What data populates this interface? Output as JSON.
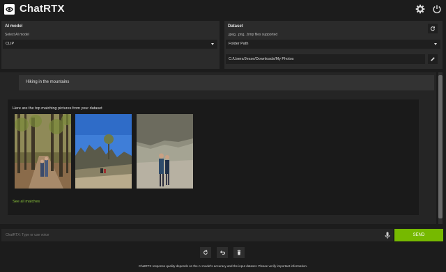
{
  "app": {
    "title": "ChatRTX"
  },
  "header": {
    "settings_icon": "gear-icon",
    "power_icon": "power-icon"
  },
  "ai_model": {
    "title": "AI model",
    "select_label": "Select AI model",
    "selected": "CLIP"
  },
  "dataset": {
    "title": "Dataset",
    "supported": ".jpeg, .png, .bmp files supported",
    "selected": "Folder Path",
    "path": "C:/Users/Jesse/Downloads/My Photos",
    "refresh_icon": "refresh-icon",
    "edit_icon": "pencil-icon"
  },
  "chat": {
    "query": "Hiking in the mountains",
    "response_text": "Here are the top matching pictures from your dataset",
    "see_all": "See all matches"
  },
  "input": {
    "placeholder": "ChatRTX: Type or use voice",
    "send_label": "SEND",
    "mic_icon": "mic-icon"
  },
  "tools": {
    "regenerate_icon": "regenerate-icon",
    "undo_icon": "undo-icon",
    "delete_icon": "trash-icon"
  },
  "footer": {
    "disclaimer": "ChatRTX response quality depends on the AI model's accuracy and the input dataset. Please verify important information."
  },
  "colors": {
    "accent": "#76b900",
    "background": "#1c1c1c",
    "panel": "#2b2b2b"
  }
}
